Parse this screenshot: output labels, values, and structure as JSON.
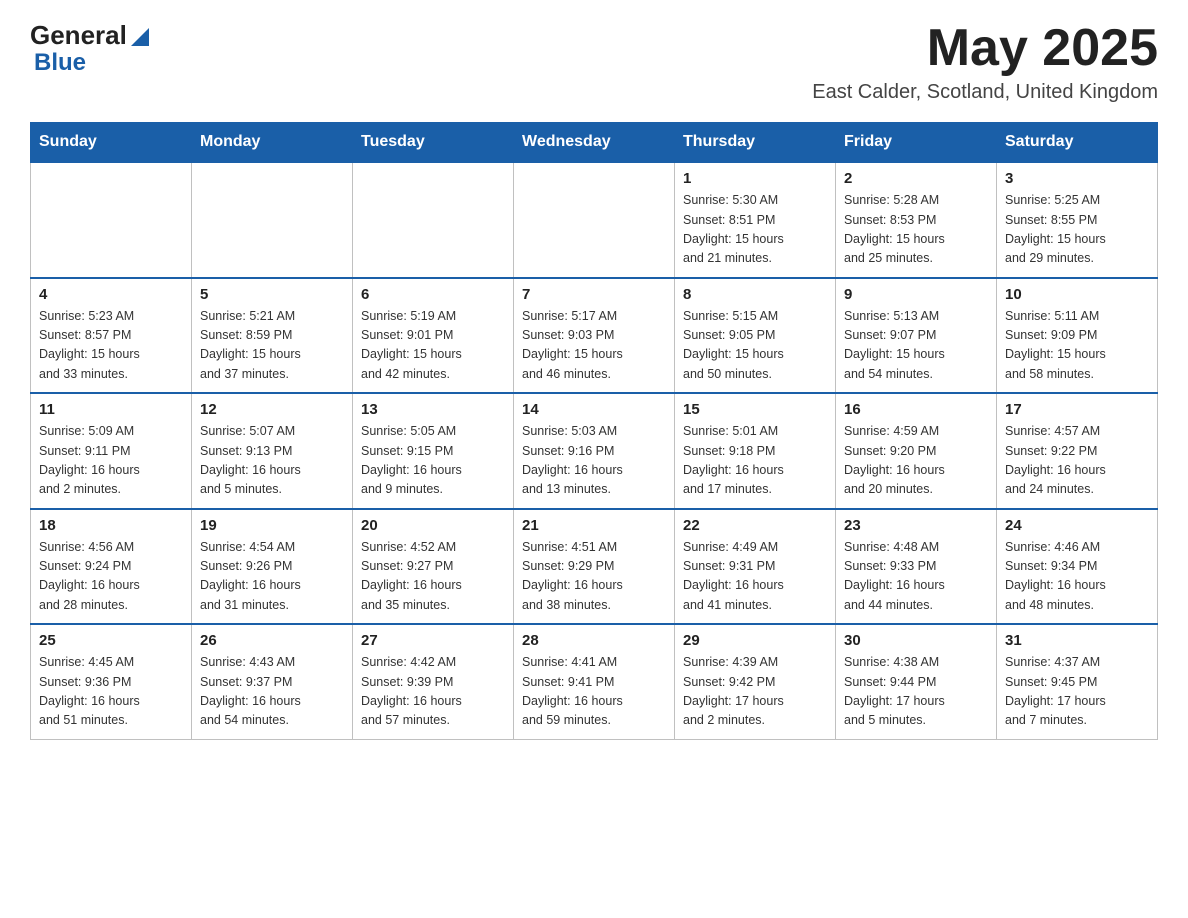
{
  "header": {
    "logo_general": "General",
    "logo_blue": "Blue",
    "main_title": "May 2025",
    "subtitle": "East Calder, Scotland, United Kingdom"
  },
  "calendar": {
    "days_of_week": [
      "Sunday",
      "Monday",
      "Tuesday",
      "Wednesday",
      "Thursday",
      "Friday",
      "Saturday"
    ],
    "weeks": [
      [
        {
          "day": "",
          "info": ""
        },
        {
          "day": "",
          "info": ""
        },
        {
          "day": "",
          "info": ""
        },
        {
          "day": "",
          "info": ""
        },
        {
          "day": "1",
          "info": "Sunrise: 5:30 AM\nSunset: 8:51 PM\nDaylight: 15 hours\nand 21 minutes."
        },
        {
          "day": "2",
          "info": "Sunrise: 5:28 AM\nSunset: 8:53 PM\nDaylight: 15 hours\nand 25 minutes."
        },
        {
          "day": "3",
          "info": "Sunrise: 5:25 AM\nSunset: 8:55 PM\nDaylight: 15 hours\nand 29 minutes."
        }
      ],
      [
        {
          "day": "4",
          "info": "Sunrise: 5:23 AM\nSunset: 8:57 PM\nDaylight: 15 hours\nand 33 minutes."
        },
        {
          "day": "5",
          "info": "Sunrise: 5:21 AM\nSunset: 8:59 PM\nDaylight: 15 hours\nand 37 minutes."
        },
        {
          "day": "6",
          "info": "Sunrise: 5:19 AM\nSunset: 9:01 PM\nDaylight: 15 hours\nand 42 minutes."
        },
        {
          "day": "7",
          "info": "Sunrise: 5:17 AM\nSunset: 9:03 PM\nDaylight: 15 hours\nand 46 minutes."
        },
        {
          "day": "8",
          "info": "Sunrise: 5:15 AM\nSunset: 9:05 PM\nDaylight: 15 hours\nand 50 minutes."
        },
        {
          "day": "9",
          "info": "Sunrise: 5:13 AM\nSunset: 9:07 PM\nDaylight: 15 hours\nand 54 minutes."
        },
        {
          "day": "10",
          "info": "Sunrise: 5:11 AM\nSunset: 9:09 PM\nDaylight: 15 hours\nand 58 minutes."
        }
      ],
      [
        {
          "day": "11",
          "info": "Sunrise: 5:09 AM\nSunset: 9:11 PM\nDaylight: 16 hours\nand 2 minutes."
        },
        {
          "day": "12",
          "info": "Sunrise: 5:07 AM\nSunset: 9:13 PM\nDaylight: 16 hours\nand 5 minutes."
        },
        {
          "day": "13",
          "info": "Sunrise: 5:05 AM\nSunset: 9:15 PM\nDaylight: 16 hours\nand 9 minutes."
        },
        {
          "day": "14",
          "info": "Sunrise: 5:03 AM\nSunset: 9:16 PM\nDaylight: 16 hours\nand 13 minutes."
        },
        {
          "day": "15",
          "info": "Sunrise: 5:01 AM\nSunset: 9:18 PM\nDaylight: 16 hours\nand 17 minutes."
        },
        {
          "day": "16",
          "info": "Sunrise: 4:59 AM\nSunset: 9:20 PM\nDaylight: 16 hours\nand 20 minutes."
        },
        {
          "day": "17",
          "info": "Sunrise: 4:57 AM\nSunset: 9:22 PM\nDaylight: 16 hours\nand 24 minutes."
        }
      ],
      [
        {
          "day": "18",
          "info": "Sunrise: 4:56 AM\nSunset: 9:24 PM\nDaylight: 16 hours\nand 28 minutes."
        },
        {
          "day": "19",
          "info": "Sunrise: 4:54 AM\nSunset: 9:26 PM\nDaylight: 16 hours\nand 31 minutes."
        },
        {
          "day": "20",
          "info": "Sunrise: 4:52 AM\nSunset: 9:27 PM\nDaylight: 16 hours\nand 35 minutes."
        },
        {
          "day": "21",
          "info": "Sunrise: 4:51 AM\nSunset: 9:29 PM\nDaylight: 16 hours\nand 38 minutes."
        },
        {
          "day": "22",
          "info": "Sunrise: 4:49 AM\nSunset: 9:31 PM\nDaylight: 16 hours\nand 41 minutes."
        },
        {
          "day": "23",
          "info": "Sunrise: 4:48 AM\nSunset: 9:33 PM\nDaylight: 16 hours\nand 44 minutes."
        },
        {
          "day": "24",
          "info": "Sunrise: 4:46 AM\nSunset: 9:34 PM\nDaylight: 16 hours\nand 48 minutes."
        }
      ],
      [
        {
          "day": "25",
          "info": "Sunrise: 4:45 AM\nSunset: 9:36 PM\nDaylight: 16 hours\nand 51 minutes."
        },
        {
          "day": "26",
          "info": "Sunrise: 4:43 AM\nSunset: 9:37 PM\nDaylight: 16 hours\nand 54 minutes."
        },
        {
          "day": "27",
          "info": "Sunrise: 4:42 AM\nSunset: 9:39 PM\nDaylight: 16 hours\nand 57 minutes."
        },
        {
          "day": "28",
          "info": "Sunrise: 4:41 AM\nSunset: 9:41 PM\nDaylight: 16 hours\nand 59 minutes."
        },
        {
          "day": "29",
          "info": "Sunrise: 4:39 AM\nSunset: 9:42 PM\nDaylight: 17 hours\nand 2 minutes."
        },
        {
          "day": "30",
          "info": "Sunrise: 4:38 AM\nSunset: 9:44 PM\nDaylight: 17 hours\nand 5 minutes."
        },
        {
          "day": "31",
          "info": "Sunrise: 4:37 AM\nSunset: 9:45 PM\nDaylight: 17 hours\nand 7 minutes."
        }
      ]
    ]
  }
}
